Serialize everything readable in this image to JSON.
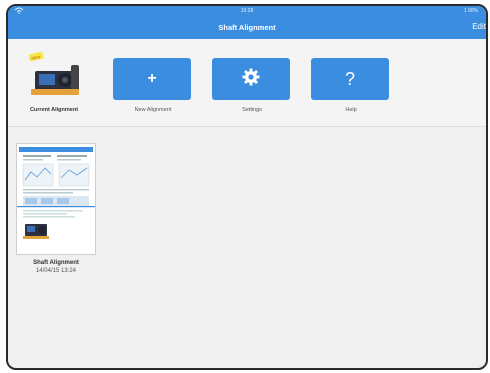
{
  "app": {
    "title": "Shaft Alignment",
    "edit_label": "Edit"
  },
  "status": {
    "time": "10:28",
    "battery": "1 90%"
  },
  "toolbar": {
    "current_label": "Current Alignment",
    "new_label": "New Alignment",
    "settings_label": "Settings",
    "help_label": "Help",
    "help_glyph": "?",
    "new_glyph": "+"
  },
  "documents": [
    {
      "name": "Shaft Alignment",
      "date": "14/04/15 13:24"
    }
  ],
  "colors": {
    "accent": "#3b8de0",
    "background": "#f0f0f0"
  }
}
